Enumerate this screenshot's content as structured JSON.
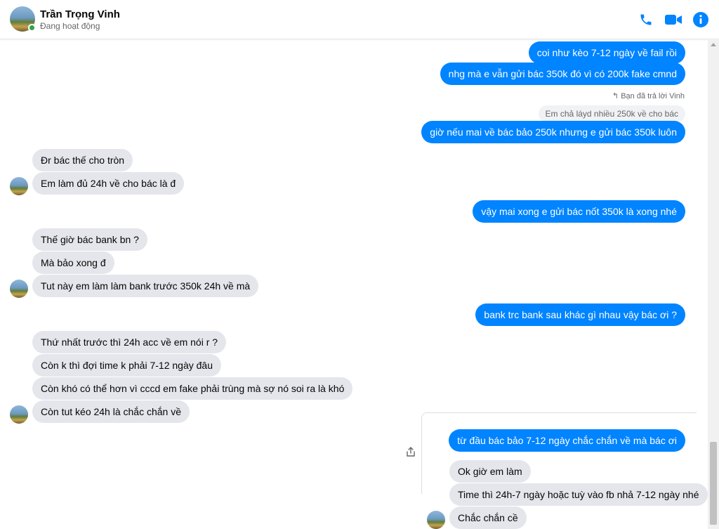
{
  "header": {
    "contact_name": "Trần Trọng Vinh",
    "status": "Đang hoạt động",
    "accent_color": "#0084ff",
    "icons": [
      "phone-icon",
      "video-camera-icon",
      "info-icon"
    ]
  },
  "messages": {
    "m1": "coi như kèo 7-12 ngày về fail rồi",
    "m2": "nhg mà e vẫn gửi bác 350k đó vì có 200k fake cmnd",
    "reply_label": "Bạn đã trả lời Vinh",
    "reply_quote": "Em chả láyd nhiều 250k về cho bác",
    "m3": "giờ nếu mai về bác bảo 250k nhưng e gửi bác 350k luôn",
    "m4": "Đr bác thế cho tròn",
    "m5": "Em làm đủ 24h về cho bác là đ",
    "m6": "vậy mai xong e gửi bác nốt 350k là xong nhé",
    "m7": "Thế giờ bác bank bn ?",
    "m8": "Mà bảo xong đ",
    "m9": "Tut này em làm làm bank trước 350k 24h về mà",
    "m10": "bank trc bank sau khác gì nhau vậy bác ơi ?",
    "m11": "Thứ nhất trước thì 24h acc về em nói r ?",
    "m12": "Còn k thì đợi time k phải 7-12 ngày đâu",
    "m13": "Còn khó có thể hơn vì cccd em fake phải trùng mà sợ nó soi ra là khó",
    "m14": "Còn tut kéo 24h là chắc chắn về",
    "m15": "từ đầu bác bảo 7-12 ngày chắc chắn về mà bác ơi",
    "m16": "Ok giờ em làm",
    "m17": "Time thì 24h-7 ngày hoặc tuỳ vào fb nhả 7-12 ngày nhé",
    "m18": "Chắc chắn cề"
  }
}
